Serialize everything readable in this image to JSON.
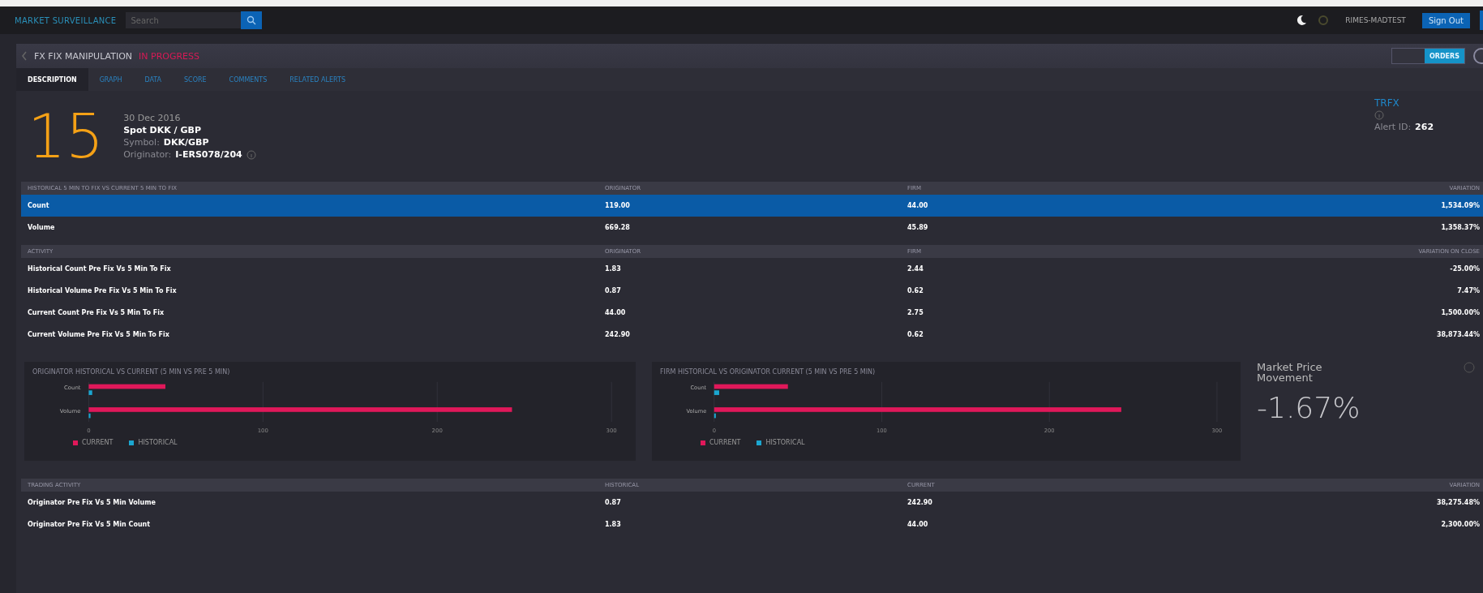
{
  "top_bar": {
    "app_name": "MARKET SURVEILLANCE",
    "search": {
      "placeholder": "Search"
    },
    "user": "RIMES-MADTEST",
    "sign_out": "Sign Out"
  },
  "alert": {
    "title": "FX FIX MANIPULATION",
    "status": "IN PROGRESS",
    "view_toggle": "ORDERS"
  },
  "tabs": [
    {
      "label": "DESCRIPTION",
      "selected": true
    },
    {
      "label": "GRAPH",
      "selected": false
    },
    {
      "label": "DATA",
      "selected": false
    },
    {
      "label": "SCORE",
      "selected": false
    },
    {
      "label": "COMMENTS",
      "selected": false
    },
    {
      "label": "RELATED ALERTS",
      "selected": false
    }
  ],
  "summary": {
    "score": "15",
    "date": "30 Dec 2016",
    "instrument": "Spot DKK / GBP",
    "symbol_label": "Symbol:",
    "symbol": "DKK/GBP",
    "originator_label": "Originator:",
    "originator": "I-ERS078/204",
    "venue": "TRFX",
    "alert_id_label": "Alert ID:",
    "alert_id": "262"
  },
  "tables": [
    {
      "columns": [
        "HISTORICAL 5 MIN TO FIX VS CURRENT 5 MIN TO FIX",
        "ORIGINATOR",
        "FIRM",
        "VARIATION"
      ],
      "rows": [
        {
          "cells": [
            "Count",
            "119.00",
            "44.00",
            "1,534.09%"
          ],
          "selected": true
        },
        {
          "cells": [
            "Volume",
            "669.28",
            "45.89",
            "1,358.37%"
          ],
          "selected": false
        }
      ]
    },
    {
      "columns": [
        "ACTIVITY",
        "ORIGINATOR",
        "FIRM",
        "VARIATION ON CLOSE"
      ],
      "rows": [
        {
          "cells": [
            "Historical Count Pre Fix Vs 5 Min To Fix",
            "1.83",
            "2.44",
            "-25.00%"
          ],
          "selected": false
        },
        {
          "cells": [
            "Historical Volume Pre Fix Vs 5 Min To Fix",
            "0.87",
            "0.62",
            "7.47%"
          ],
          "selected": false
        },
        {
          "cells": [
            "Current Count Pre Fix Vs 5 Min To Fix",
            "44.00",
            "2.75",
            "1,500.00%"
          ],
          "selected": false
        },
        {
          "cells": [
            "Current Volume Pre Fix Vs 5 Min To Fix",
            "242.90",
            "0.62",
            "38,873.44%"
          ],
          "selected": false
        }
      ]
    }
  ],
  "charts": [
    {
      "chart_data": {
        "type": "bar",
        "orientation": "horizontal",
        "title": "ORIGINATOR HISTORICAL VS CURRENT (5 MIN VS PRE 5 MIN)",
        "categories": [
          "Count",
          "Volume"
        ],
        "series": [
          {
            "name": "CURRENT",
            "color": "#e0185a",
            "values": [
              44,
              242.9
            ]
          },
          {
            "name": "HISTORICAL",
            "color": "#1ba6d0",
            "values": [
              2,
              1
            ]
          }
        ],
        "xlim": [
          0,
          300
        ],
        "xticks": [
          0,
          100,
          200,
          300
        ],
        "legend": true
      }
    },
    {
      "chart_data": {
        "type": "bar",
        "orientation": "horizontal",
        "title": "FIRM HISTORICAL VS ORIGINATOR CURRENT (5 MIN VS PRE 5 MIN)",
        "categories": [
          "Count",
          "Volume"
        ],
        "series": [
          {
            "name": "CURRENT",
            "color": "#e0185a",
            "values": [
              44,
              242.9
            ]
          },
          {
            "name": "HISTORICAL",
            "color": "#1ba6d0",
            "values": [
              3,
              1
            ]
          }
        ],
        "xlim": [
          0,
          300
        ],
        "xticks": [
          0,
          100,
          200,
          300
        ],
        "legend": true
      }
    }
  ],
  "market_price": {
    "title": "Market Price Movement",
    "value": "-1.67%"
  },
  "trading_table": {
    "columns": [
      "TRADING ACTIVITY",
      "HISTORICAL",
      "CURRENT",
      "VARIATION"
    ],
    "rows": [
      {
        "cells": [
          "Originator Pre Fix Vs 5 Min Volume",
          "0.87",
          "242.90",
          "38,275.48%"
        ],
        "selected": false
      },
      {
        "cells": [
          "Originator Pre Fix Vs 5 Min Count",
          "1.83",
          "44.00",
          "2,300.00%"
        ],
        "selected": false
      }
    ]
  }
}
